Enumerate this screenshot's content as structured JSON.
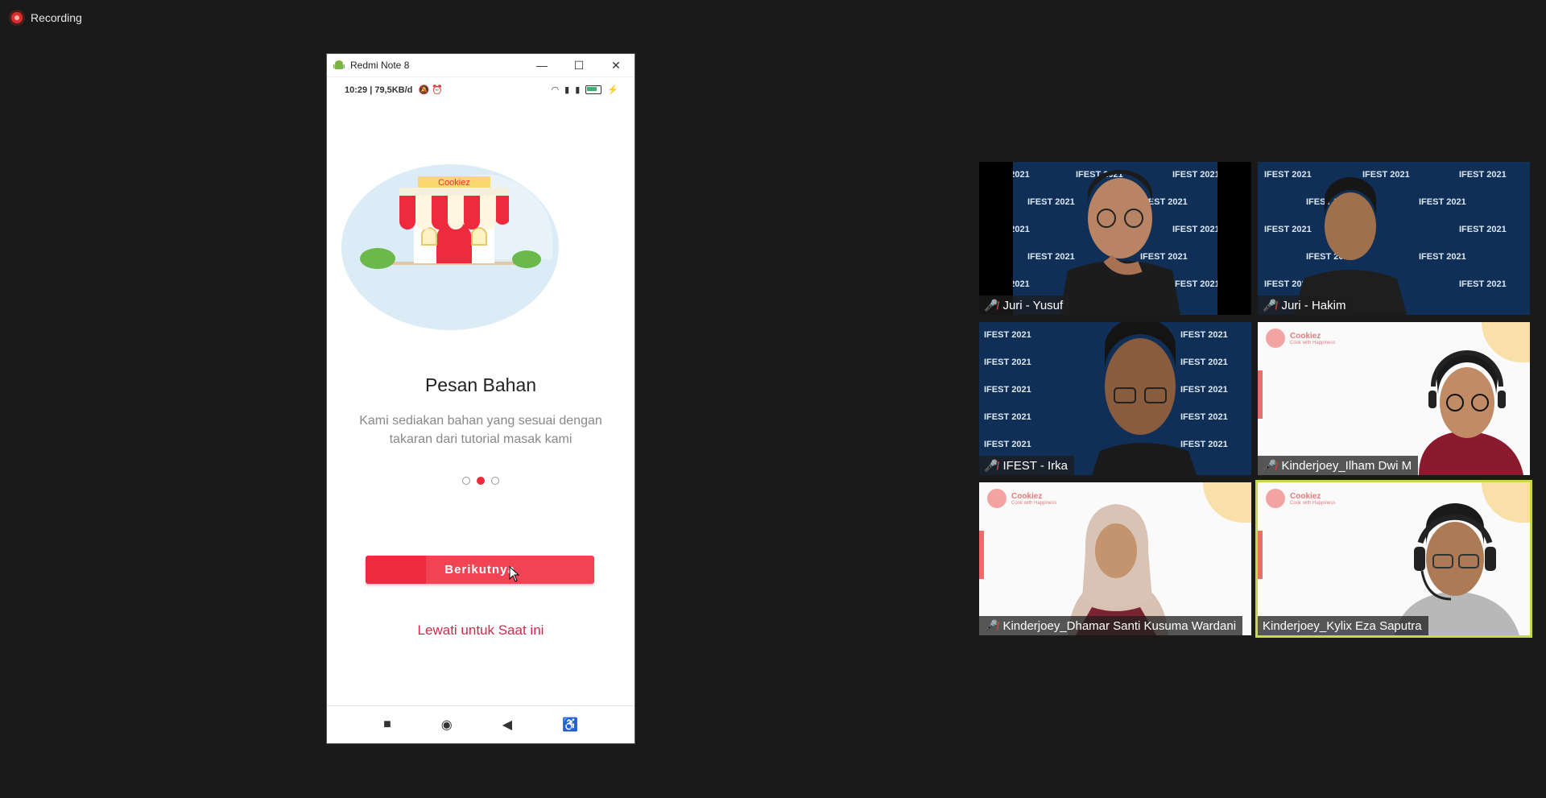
{
  "recording": {
    "label": "Recording"
  },
  "phone_window": {
    "title": "Redmi Note 8",
    "controls": {
      "minimize": "—",
      "maximize": "☐",
      "close": "✕"
    },
    "status_bar": {
      "time_speed": "10:29 | 79,5KB/d"
    },
    "app": {
      "store_sign": "Cookiez",
      "title": "Pesan Bahan",
      "description": "Kami sediakan bahan yang sesuai dengan takaran dari tutorial masak kami",
      "pager": {
        "total": 3,
        "active_index": 1
      },
      "next_button": "Berikutnya",
      "skip_link": "Lewati untuk Saat ini"
    },
    "nav_icons": [
      "stop-square-icon",
      "home-circle-icon",
      "back-triangle-icon",
      "accessibility-icon"
    ]
  },
  "participants": [
    {
      "name": "Juri - Yusuf",
      "muted": true,
      "background": "ifest"
    },
    {
      "name": "Juri - Hakim",
      "muted": true,
      "background": "ifest"
    },
    {
      "name": "IFEST - Irka",
      "muted": true,
      "background": "ifest"
    },
    {
      "name": "Kinderjoey_Ilham Dwi M",
      "muted": true,
      "background": "cookiez"
    },
    {
      "name": "Kinderjoey_Dhamar Santi Kusuma Wardani",
      "muted": true,
      "background": "cookiez"
    },
    {
      "name": "Kinderjoey_Kylix Eza Saputra",
      "muted": false,
      "background": "cookiez",
      "speaking": true
    }
  ],
  "backdrop": {
    "ifest_text": "IFEST 2021",
    "cookiez_brand": "Cookiez",
    "cookiez_tagline": "Cook with Happiness"
  },
  "colors": {
    "accent": "#ee2b3e",
    "speaking_border": "#c8d84a",
    "background": "#1a1a1a"
  }
}
